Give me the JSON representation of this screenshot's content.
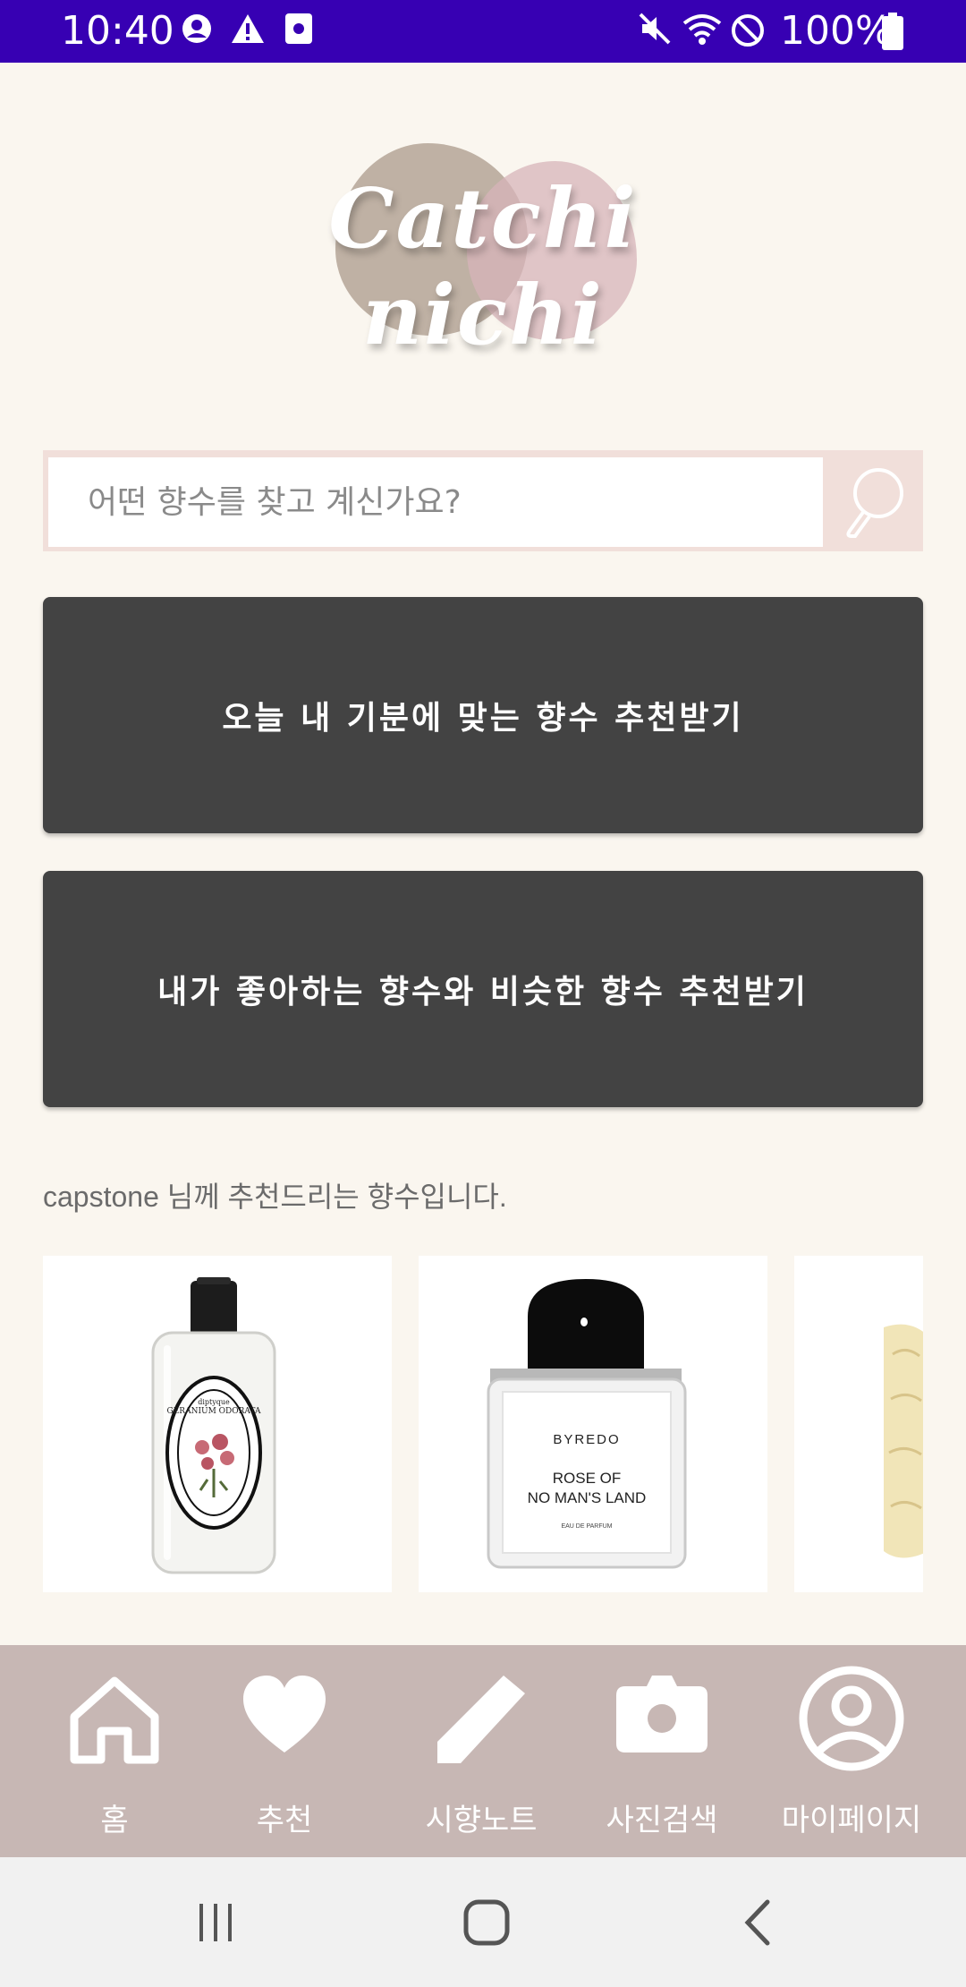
{
  "status_bar": {
    "time": "10:40",
    "battery": "100%",
    "left_icons": [
      "account-circle-icon",
      "warning-icon",
      "screenshot-icon"
    ],
    "right_icons": [
      "mute-icon",
      "wifi-icon",
      "do-not-disturb-icon",
      "battery-icon"
    ]
  },
  "logo": {
    "text": "Catchi nichi"
  },
  "search": {
    "placeholder": "어떤 향수를 찾고 계신가요?",
    "value": "",
    "icon": "search-icon"
  },
  "buttons": {
    "mood": "오늘 내 기분에 맞는 향수 추천받기",
    "similar": "내가 좋아하는 향수와 비슷한 향수 추천받기"
  },
  "recommendations": {
    "heading": "capstone 님께 추천드리는 향수입니다.",
    "items": [
      {
        "brand": "diptyque",
        "label": "GERANIUM ODORATA"
      },
      {
        "brand": "BYREDO",
        "name": "ROSE OF NO MAN'S LAND",
        "subtitle": "EAU DE PARFUM"
      },
      {
        "name": ""
      }
    ]
  },
  "bottom_nav": [
    {
      "label": "홈",
      "icon": "home-icon"
    },
    {
      "label": "추천",
      "icon": "heart-icon"
    },
    {
      "label": "시향노트",
      "icon": "pencil-icon"
    },
    {
      "label": "사진검색",
      "icon": "camera-icon"
    },
    {
      "label": "마이페이지",
      "icon": "profile-icon"
    }
  ],
  "system_nav": [
    "recents-icon",
    "home-circle-icon",
    "back-icon"
  ],
  "colors": {
    "status_bar": "#3700b3",
    "background": "#faf6ef",
    "button": "#434343",
    "search_accent": "#f1dfda",
    "bottom_nav": "#c7b7b4"
  }
}
